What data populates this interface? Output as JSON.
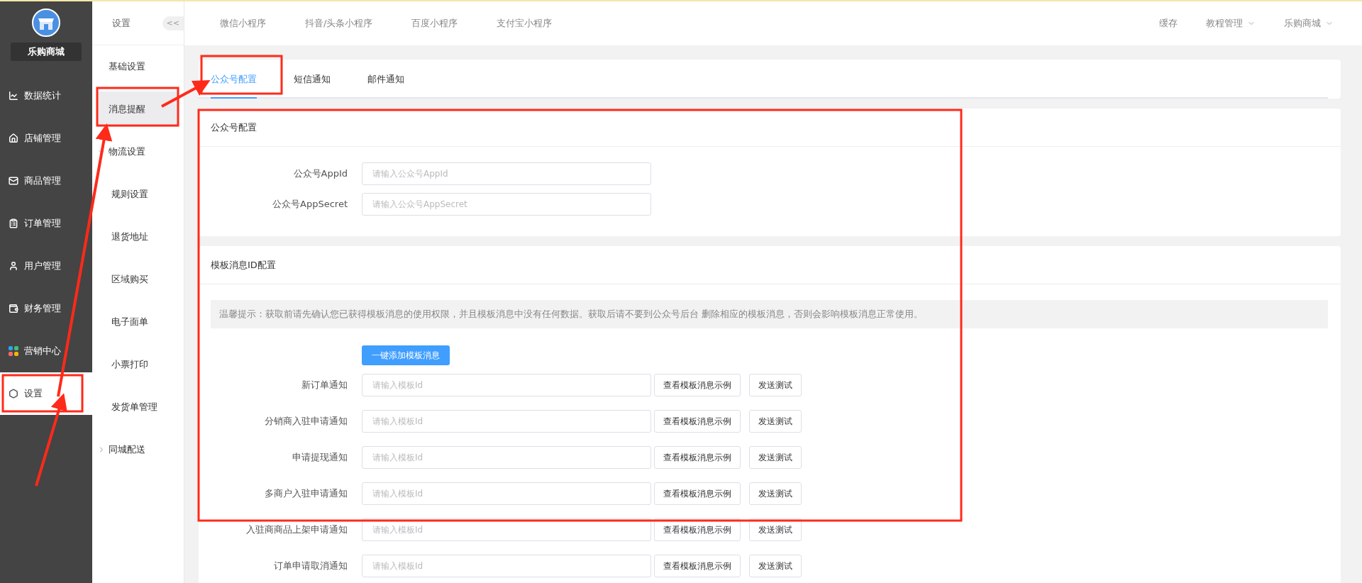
{
  "sidebar": {
    "store_name": "乐购商城",
    "items": [
      {
        "label": "数据统计",
        "selected": false
      },
      {
        "label": "店铺管理",
        "selected": false
      },
      {
        "label": "商品管理",
        "selected": false
      },
      {
        "label": "订单管理",
        "selected": false
      },
      {
        "label": "用户管理",
        "selected": false
      },
      {
        "label": "财务管理",
        "selected": false
      },
      {
        "label": "营销中心",
        "selected": false
      },
      {
        "label": "设置",
        "selected": true
      }
    ]
  },
  "subnav": {
    "title": "设置",
    "collapse_button": "<<",
    "items": [
      {
        "label": "基础设置",
        "selected": false
      },
      {
        "label": "消息提醒",
        "selected": true
      },
      {
        "label": "物流设置",
        "selected": false,
        "expanded": true,
        "children": [
          {
            "label": "规则设置",
            "selected": false
          },
          {
            "label": "退货地址",
            "selected": false
          },
          {
            "label": "区域购买",
            "selected": false
          },
          {
            "label": "电子面单",
            "selected": false
          },
          {
            "label": "小票打印",
            "selected": false
          },
          {
            "label": "发货单管理",
            "selected": false
          }
        ]
      },
      {
        "label": "同城配送",
        "selected": false,
        "expanded": false
      }
    ]
  },
  "topbar": {
    "tabs": [
      {
        "label": "微信小程序",
        "selected": false
      },
      {
        "label": "抖音/头条小程序",
        "selected": false
      },
      {
        "label": "百度小程序",
        "selected": false
      },
      {
        "label": "支付宝小程序",
        "selected": false
      }
    ],
    "actions": [
      {
        "label": "缓存",
        "kind": "link"
      },
      {
        "label": "教程管理",
        "kind": "dropdown"
      },
      {
        "label": "乐购商城",
        "kind": "dropdown"
      }
    ]
  },
  "tabs": [
    {
      "label": "公众号配置",
      "selected": true
    },
    {
      "label": "短信通知",
      "selected": false
    },
    {
      "label": "邮件通知",
      "selected": false
    }
  ],
  "account_card": {
    "title": "公众号配置",
    "fields": [
      {
        "label": "公众号AppId",
        "placeholder": "请输入公众号AppId"
      },
      {
        "label": "公众号AppSecret",
        "placeholder": "请输入公众号AppSecret"
      }
    ]
  },
  "template_card": {
    "title": "模板消息ID配置",
    "tip": "温馨提示：获取前请先确认您已获得模板消息的使用权限，并且模板消息中没有任何数据。获取后请不要到公众号后台 删除相应的模板消息，否则会影响模板消息正常使用。",
    "add_button": "一键添加模板消息",
    "rows": [
      {
        "label": "新订单通知",
        "placeholder": "请输入模板Id",
        "example_button": "查看模板消息示例",
        "test_button": "发送测试"
      },
      {
        "label": "分销商入驻申请通知",
        "placeholder": "请输入模板Id",
        "example_button": "查看模板消息示例",
        "test_button": "发送测试"
      },
      {
        "label": "申请提现通知",
        "placeholder": "请输入模板Id",
        "example_button": "查看模板消息示例",
        "test_button": "发送测试"
      },
      {
        "label": "多商户入驻申请通知",
        "placeholder": "请输入模板Id",
        "example_button": "查看模板消息示例",
        "test_button": "发送测试"
      },
      {
        "label": "入驻商商品上架申请通知",
        "placeholder": "请输入模板Id",
        "example_button": "查看模板消息示例",
        "test_button": "发送测试"
      },
      {
        "label": "订单申请取消通知",
        "placeholder": "请输入模板Id",
        "example_button": "查看模板消息示例",
        "test_button": "发送测试"
      }
    ]
  }
}
